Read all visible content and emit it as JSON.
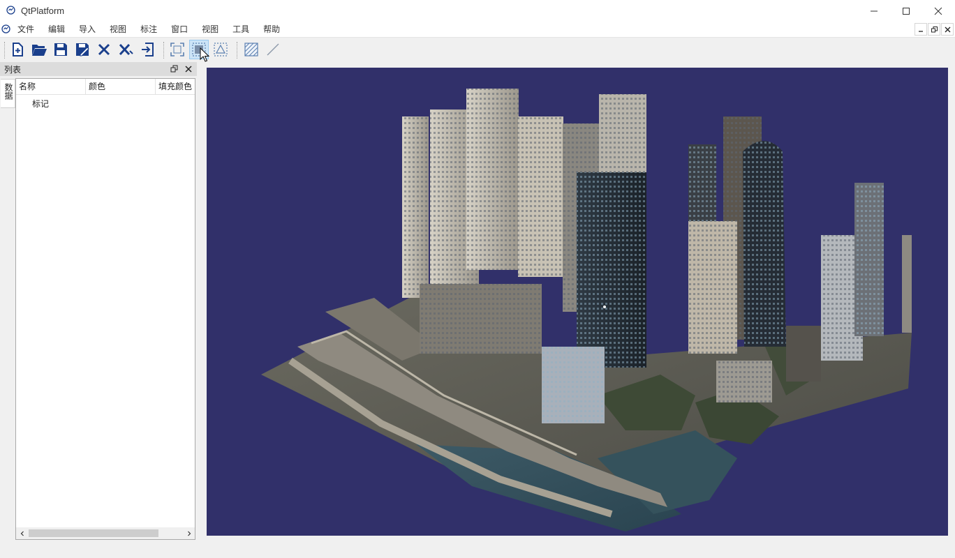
{
  "window": {
    "title": "QtPlatform",
    "controls": [
      "minimize-icon",
      "maximize-icon",
      "close-icon"
    ]
  },
  "menu": {
    "items": [
      "文件",
      "编辑",
      "导入",
      "视图",
      "标注",
      "窗口",
      "视图",
      "工具",
      "帮助"
    ]
  },
  "toolbar": {
    "groups": [
      [
        "new-file-icon",
        "open-folder-icon",
        "save-icon",
        "save-as-icon",
        "close-x-icon",
        "close-all-icon",
        "exit-icon"
      ],
      [
        "fit-view-icon",
        "select-object-icon",
        "select-region-icon"
      ],
      [
        "hatch-fill-icon",
        "line-tool-icon"
      ]
    ]
  },
  "dock": {
    "title": "列表",
    "side_tab": "数据",
    "columns": [
      "名称",
      "颜色",
      "填充颜色"
    ],
    "rows": [
      {
        "name": "标记"
      }
    ]
  },
  "viewport": {
    "background": "#31306a",
    "content": "3D city model"
  },
  "colors": {
    "accent": "#1a3f8c",
    "viewport_bg": "#31306a"
  }
}
